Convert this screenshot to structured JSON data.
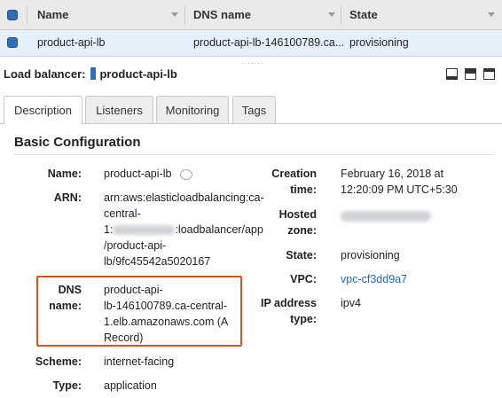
{
  "table": {
    "columns": [
      "Name",
      "DNS name",
      "State"
    ],
    "row": {
      "name": "product-api-lb",
      "dns_name": "product-api-lb-146100789.ca...",
      "state": "provisioning"
    }
  },
  "detail": {
    "label": "Load balancer:",
    "name": "product-api-lb"
  },
  "tabs": [
    "Description",
    "Listeners",
    "Monitoring",
    "Tags"
  ],
  "active_tab": "Description",
  "section": {
    "title": "Basic Configuration",
    "left": {
      "name_label": "Name:",
      "name_value": "product-api-lb",
      "arn_label": "ARN:",
      "arn_line1": "arn:aws:elasticloadbalancing:ca-",
      "arn_line2": "central-",
      "arn_line3_prefix": "1:",
      "arn_line3_suffix": ":loadbalancer/app",
      "arn_line4": "/product-api-",
      "arn_line5": "lb/9fc45542a5020167",
      "dns_label_1": "DNS",
      "dns_label_2": "name:",
      "dns_line1": "product-api-",
      "dns_line2": "lb-146100789.ca-central-",
      "dns_line3": "1.elb.amazonaws.com (A",
      "dns_line4": "Record)",
      "scheme_label": "Scheme:",
      "scheme_value": "internet-facing",
      "type_label": "Type:",
      "type_value": "application"
    },
    "right": {
      "creation_label_1": "Creation",
      "creation_label_2": "time:",
      "creation_line1": "February 16, 2018 at",
      "creation_line2": "12:20:09 PM UTC+5:30",
      "hosted_label_1": "Hosted",
      "hosted_label_2": "zone:",
      "state_label": "State:",
      "state_value": "provisioning",
      "vpc_label": "VPC:",
      "vpc_value": "vpc-cf3dd9a7",
      "ip_label_1": "IP address",
      "ip_label_2": "type:",
      "ip_value": "ipv4"
    }
  },
  "colors": {
    "accent": "#2f6fba",
    "highlight_border": "#e0521c",
    "link": "#1b6ac9",
    "selected_row": "#e6f0fa"
  }
}
